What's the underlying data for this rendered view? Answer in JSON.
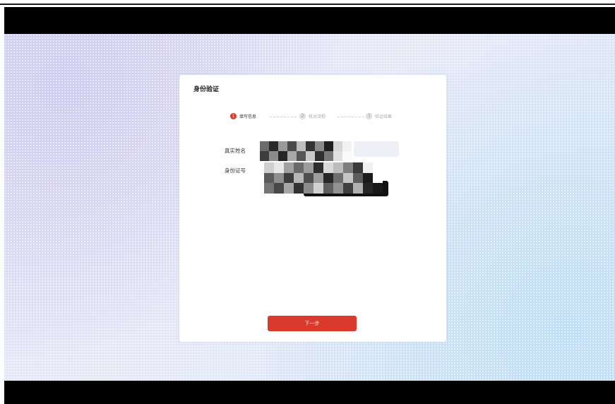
{
  "card": {
    "title": "身份验证"
  },
  "steps": [
    {
      "number": "1",
      "label": "填写信息",
      "state": "active"
    },
    {
      "number": "2",
      "label": "核对流程",
      "state": "inactive"
    },
    {
      "number": "3",
      "label": "验证结果",
      "state": "inactive"
    }
  ],
  "form": {
    "name_label": "真实姓名",
    "id_label": "身份证号"
  },
  "actions": {
    "next_label": "下一步"
  },
  "colors": {
    "accent": "#d93a2b",
    "page_bg": "#e2e4f5",
    "card_bg": "#ffffff"
  }
}
